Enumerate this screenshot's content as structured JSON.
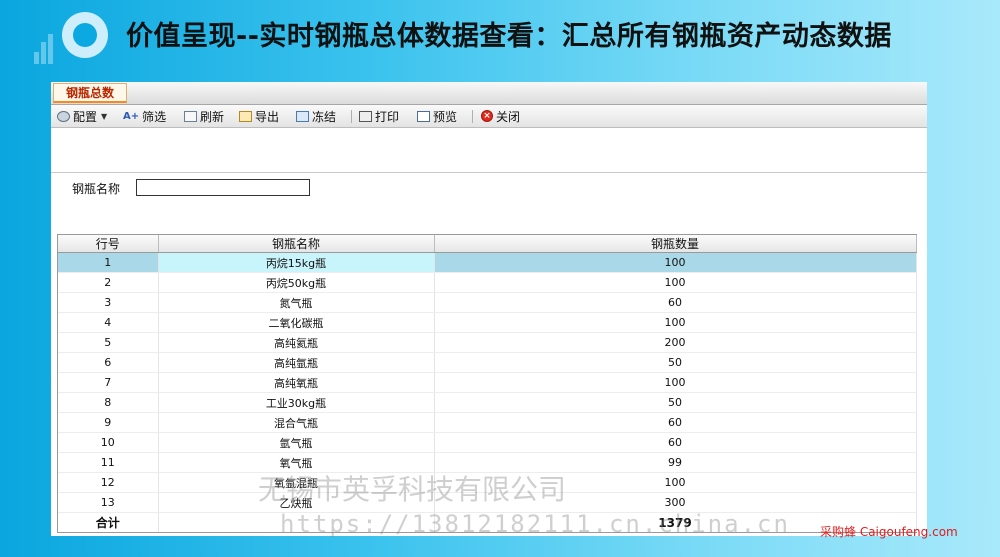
{
  "slide_title": "价值呈现--实时钢瓶总体数据查看：汇总所有钢瓶资产动态数据",
  "tab": {
    "label": "钢瓶总数"
  },
  "toolbar": {
    "config": "配置",
    "filter_icon_text": "A+",
    "filter": "筛选",
    "refresh": "刷新",
    "export": "导出",
    "freeze": "冻结",
    "print": "打印",
    "preview": "预览",
    "close": "关闭"
  },
  "icons": [
    "config-icon",
    "filter-icon",
    "refresh-icon",
    "export-icon",
    "freeze-icon",
    "print-icon",
    "preview-icon",
    "close-icon"
  ],
  "form": {
    "name_label": "钢瓶名称",
    "name_value": ""
  },
  "grid": {
    "headers": [
      "行号",
      "钢瓶名称",
      "钢瓶数量"
    ],
    "rows": [
      [
        "1",
        "丙烷15kg瓶",
        "100"
      ],
      [
        "2",
        "丙烷50kg瓶",
        "100"
      ],
      [
        "3",
        "氮气瓶",
        "60"
      ],
      [
        "4",
        "二氧化碳瓶",
        "100"
      ],
      [
        "5",
        "高纯氦瓶",
        "200"
      ],
      [
        "6",
        "高纯氩瓶",
        "50"
      ],
      [
        "7",
        "高纯氧瓶",
        "100"
      ],
      [
        "8",
        "工业30kg瓶",
        "50"
      ],
      [
        "9",
        "混合气瓶",
        "60"
      ],
      [
        "10",
        "氩气瓶",
        "60"
      ],
      [
        "11",
        "氧气瓶",
        "99"
      ],
      [
        "12",
        "氧氩混瓶",
        "100"
      ],
      [
        "13",
        "乙炔瓶",
        "300"
      ]
    ],
    "selected_row": 1,
    "total": {
      "label": "合计",
      "value": "1379"
    }
  },
  "watermark": {
    "company": "无锡市英孚科技有限公司",
    "url": "https://13812182111.cn.china.cn"
  },
  "brand": "采购蜂 Caigoufeng.com",
  "colors": {
    "tab_accent": "#f58a1f",
    "tab_text": "#b82800",
    "selected_row": "#a9d9e9",
    "selected_cell": "#c8f4fb",
    "brand": "#e01b1b"
  }
}
